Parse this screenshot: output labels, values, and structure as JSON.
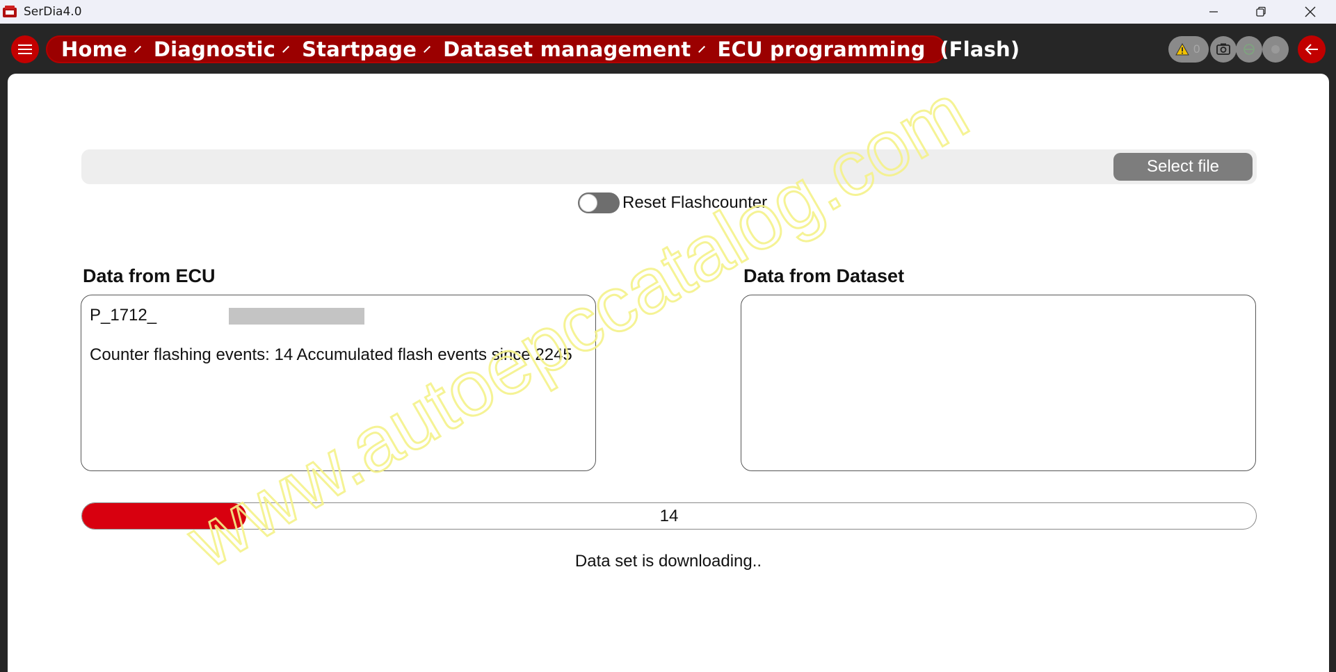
{
  "window": {
    "title": "SerDia4.0"
  },
  "breadcrumb": {
    "items": [
      {
        "label": "Home"
      },
      {
        "label": "Diagnostic"
      },
      {
        "label": "Startpage"
      },
      {
        "label": "Dataset management"
      },
      {
        "label": "ECU programming  (Flash)"
      }
    ]
  },
  "status": {
    "warning_count": "0"
  },
  "file": {
    "select_label": "Select file"
  },
  "options": {
    "reset_flashcounter_label": "Reset Flashcounter",
    "reset_flashcounter_on": false
  },
  "ecu": {
    "title": "Data from ECU",
    "part_prefix": "P_1712_",
    "counter_text": "Counter flashing events: 14 Accumulated flash events since 2245"
  },
  "dataset": {
    "title": "Data from Dataset"
  },
  "progress": {
    "label": "14",
    "value_percent": 14
  },
  "message": "Data set is downloading..",
  "watermark": "www.autoepccatalog.com",
  "colors": {
    "brand_red": "#c20000",
    "progress_red": "#d8000f",
    "watermark_yellow": "#f7f7a0"
  }
}
